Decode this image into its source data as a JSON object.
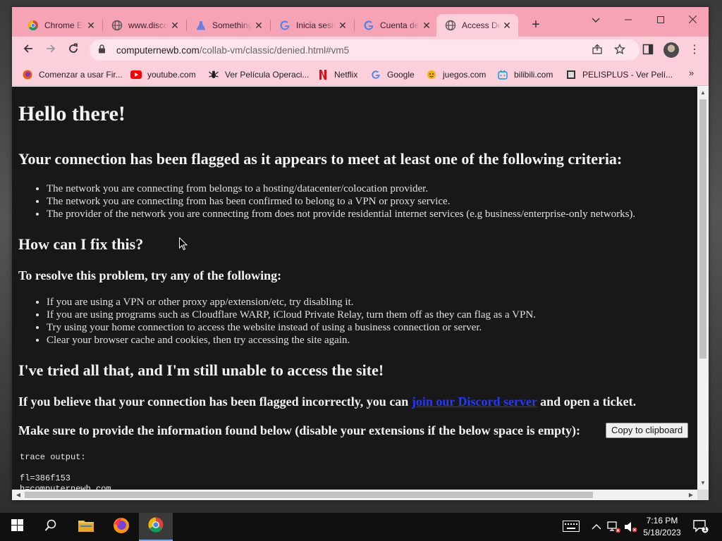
{
  "browser": {
    "tabs": [
      {
        "label": "Chrome Enterprise",
        "favicon": "chrome-icon",
        "active": false
      },
      {
        "label": "www.discord.com",
        "favicon": "globe-icon",
        "active": false
      },
      {
        "label": "Something went wrong",
        "favicon": "flask-icon",
        "active": false
      },
      {
        "label": "Inicia sesión",
        "favicon": "google-icon",
        "active": false
      },
      {
        "label": "Cuenta de Google",
        "favicon": "google-icon",
        "active": false
      },
      {
        "label": "Access Denied",
        "favicon": "globe-icon",
        "active": true
      }
    ],
    "new_tab": "+",
    "url_host": "computernewb.com",
    "url_path": "/collab-vm/classic/denied.html#vm5",
    "bookmarks": [
      {
        "label": "Comenzar a usar Fir...",
        "icon": "firefox-icon",
        "color": "#e66000"
      },
      {
        "label": "youtube.com",
        "icon": "youtube-icon",
        "color": "#ff0000"
      },
      {
        "label": "Ver Película Operaci...",
        "icon": "spider-icon",
        "color": "#222222"
      },
      {
        "label": "Netflix",
        "icon": "netflix-icon",
        "color": "#e50914"
      },
      {
        "label": "Google",
        "icon": "google-icon",
        "color": "#4285f4"
      },
      {
        "label": "juegos.com",
        "icon": "juegos-icon",
        "color": "#f4b400"
      },
      {
        "label": "bilibili.com",
        "icon": "bilibili-icon",
        "color": "#00a1d6"
      },
      {
        "label": "PELISPLUS - Ver Pelí...",
        "icon": "pelisplus-icon",
        "color": "#333333"
      }
    ],
    "bookmarks_more": "»"
  },
  "page": {
    "title": "Hello there!",
    "criteria_heading": "Your connection has been flagged as it appears to meet at least one of the following criteria:",
    "criteria": [
      "The network you are connecting from belongs to a hosting/datacenter/colocation provider.",
      "The network you are connecting from has been confirmed to belong to a VPN or proxy service.",
      "The provider of the network you are connecting from does not provide residential internet services (e.g business/enterprise-only networks)."
    ],
    "fix_heading": "How can I fix this?",
    "resolve_heading": "To resolve this problem, try any of the following:",
    "resolve_items": [
      "If you are using a VPN or other proxy app/extension/etc, try disabling it.",
      "If you are using programs such as Cloudflare WARP, iCloud Private Relay, turn them off as they can flag as a VPN.",
      "Try using your home connection to access the website instead of using a business connection or server.",
      "Clear your browser cache and cookies, then try accessing the site again."
    ],
    "still_heading": "I've tried all that, and I'm still unable to access the site!",
    "incorrect_prefix": "If you believe that your connection has been flagged incorrectly, you can ",
    "discord_link": "join our Discord server",
    "incorrect_suffix": " and open a ticket.",
    "provide_info": "Make sure to provide the information found below (disable your extensions if the below space is empty):",
    "copy_button": "Copy to clipboard",
    "trace_label": "trace output:",
    "trace_lines": [
      "fl=386f153",
      "h=computernewb.com"
    ]
  },
  "taskbar": {
    "time": "7:16 PM",
    "date": "5/18/2023",
    "notifications": "1"
  }
}
